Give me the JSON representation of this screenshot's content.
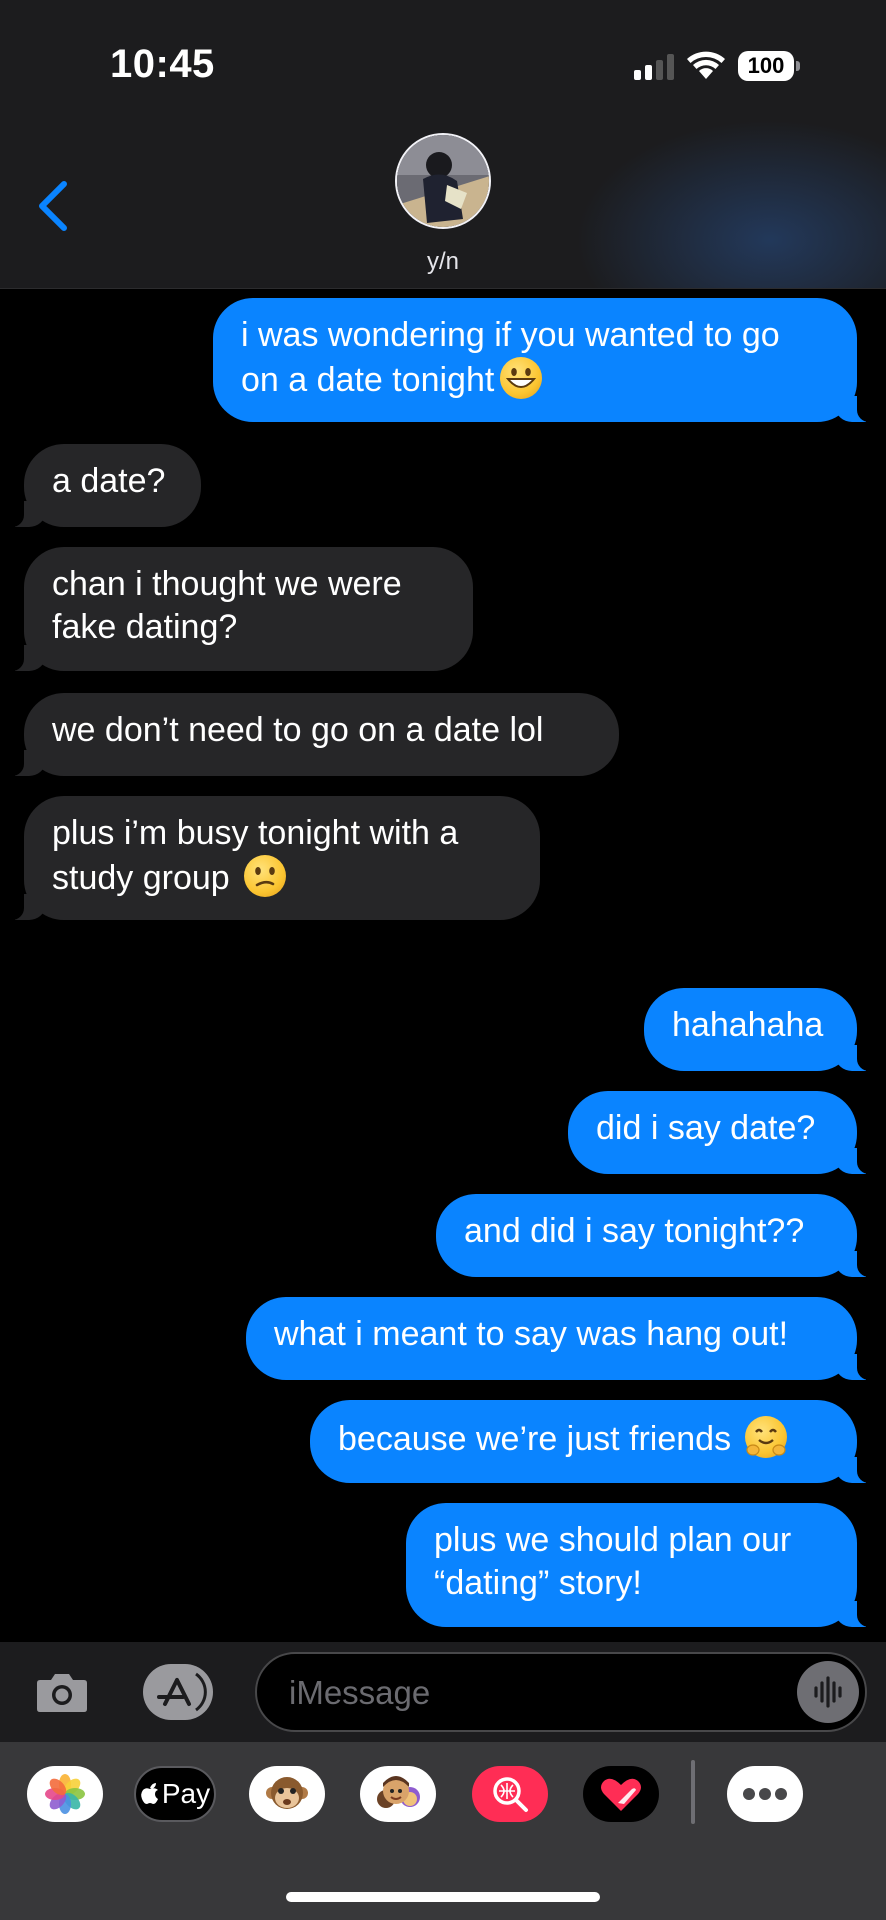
{
  "status_bar": {
    "time": "10:45",
    "battery": "100"
  },
  "header": {
    "contact_name": "y/n"
  },
  "messages": [
    {
      "from": "me",
      "lines": [
        "i was wondering if you wanted to go",
        "on a date tonight"
      ],
      "emoji": "grinning-face"
    },
    {
      "from": "them",
      "lines": [
        "a date?"
      ]
    },
    {
      "from": "them",
      "lines": [
        "chan i thought we were",
        "fake dating?"
      ]
    },
    {
      "from": "them",
      "lines": [
        "we don’t need to go on a date lol"
      ]
    },
    {
      "from": "them",
      "lines": [
        "plus i’m busy tonight with a",
        "study group"
      ],
      "emoji": "confused-face"
    },
    {
      "from": "me",
      "lines": [
        "hahahaha"
      ]
    },
    {
      "from": "me",
      "lines": [
        "did i say date?"
      ]
    },
    {
      "from": "me",
      "lines": [
        "and did i say tonight??"
      ]
    },
    {
      "from": "me",
      "lines": [
        "what i meant to say was hang out!"
      ]
    },
    {
      "from": "me",
      "lines": [
        "because we’re just friends"
      ],
      "emoji": "hugging-face"
    },
    {
      "from": "me",
      "lines": [
        "plus we should plan our",
        "“dating” story!"
      ]
    }
  ],
  "compose": {
    "placeholder": "iMessage"
  },
  "app_drawer": {
    "items": [
      {
        "name": "photos-app-icon"
      },
      {
        "name": "apple-pay-icon",
        "label": "Pay"
      },
      {
        "name": "animoji-icon"
      },
      {
        "name": "memoji-icon"
      },
      {
        "name": "image-search-icon"
      },
      {
        "name": "digital-touch-icon"
      },
      {
        "name": "more-apps-icon"
      }
    ]
  },
  "colors": {
    "sent_bubble": "#0a84ff",
    "received_bubble": "#262628",
    "accent": "#0a84ff",
    "background": "#000000"
  }
}
